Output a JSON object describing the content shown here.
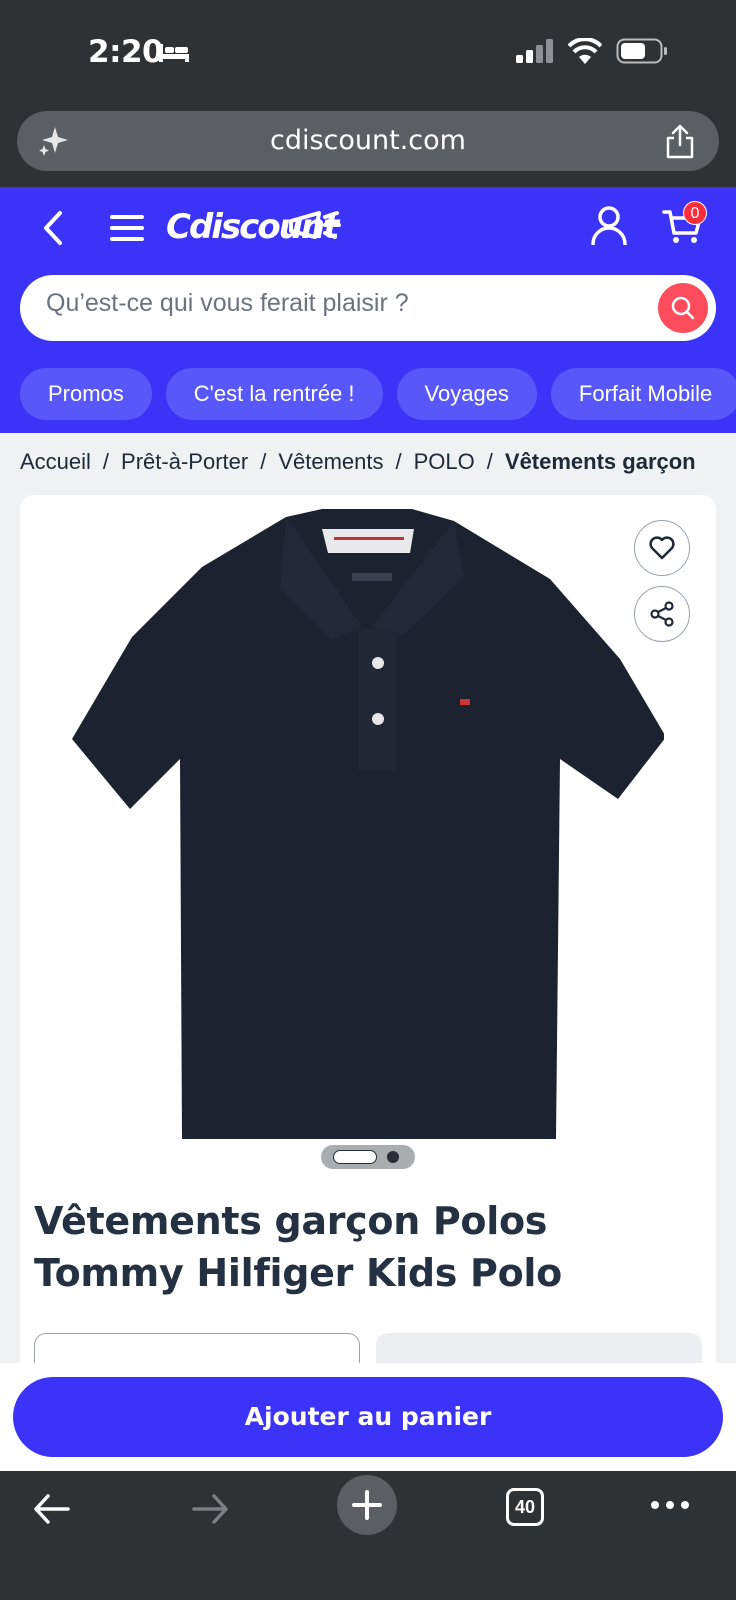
{
  "status_bar": {
    "time": "2:20",
    "icons": [
      "bed-icon",
      "signal-icon",
      "wifi-icon",
      "battery-icon"
    ]
  },
  "browser": {
    "url": "cdiscount.com",
    "tab_count": "40",
    "toolbar_icons": [
      "back-arrow-icon",
      "forward-arrow-icon",
      "plus-icon",
      "tabs-icon",
      "more-icon"
    ]
  },
  "header": {
    "logo": "Cdiscount",
    "cart_count": "0",
    "search": {
      "placeholder": "Qu’est-ce qui vous ferait plaisir ?"
    },
    "chips": [
      "Promos",
      "C'est la rentrée !",
      "Voyages",
      "Forfait Mobile"
    ]
  },
  "breadcrumb": {
    "items": [
      "Accueil",
      "Prêt-à-Porter",
      "Vêtements",
      "POLO"
    ],
    "current": "Vêtements garçon"
  },
  "product": {
    "title": "Vêtements garçon Polos Tommy Hilfiger Kids Polo",
    "image_count": 2,
    "active_image": 1
  },
  "footer": {
    "add_to_cart": "Ajouter au panier"
  },
  "colors": {
    "brand": "#3c33f8",
    "accent_red": "#ff4c5c",
    "chip": "#5858fa",
    "polo": "#1d2230"
  }
}
